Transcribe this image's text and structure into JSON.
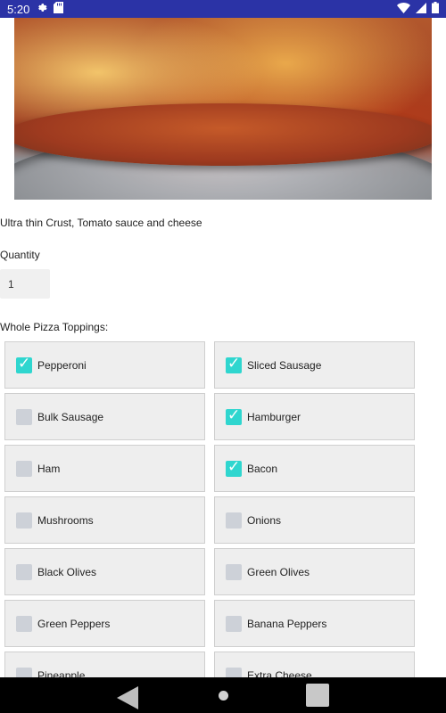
{
  "status_bar": {
    "time": "5:20",
    "left_icons": [
      "gear-icon",
      "sd-card-icon"
    ],
    "right_icons": [
      "wifi-icon",
      "cellular-icon",
      "battery-icon"
    ]
  },
  "product": {
    "description": "Ultra thin Crust, Tomato sauce and cheese"
  },
  "quantity": {
    "label": "Quantity",
    "value": "1"
  },
  "toppings": {
    "label": "Whole Pizza Toppings:",
    "items": [
      {
        "label": "Pepperoni",
        "checked": true
      },
      {
        "label": "Sliced Sausage",
        "checked": true
      },
      {
        "label": "Bulk Sausage",
        "checked": false
      },
      {
        "label": "Hamburger",
        "checked": true
      },
      {
        "label": "Ham",
        "checked": false
      },
      {
        "label": "Bacon",
        "checked": true
      },
      {
        "label": "Mushrooms",
        "checked": false
      },
      {
        "label": "Onions",
        "checked": false
      },
      {
        "label": "Black Olives",
        "checked": false
      },
      {
        "label": "Green Olives",
        "checked": false
      },
      {
        "label": "Green Peppers",
        "checked": false
      },
      {
        "label": "Banana Peppers",
        "checked": false
      },
      {
        "label": "Pineapple",
        "checked": false
      },
      {
        "label": "Extra Cheese",
        "checked": false
      }
    ]
  },
  "nav_bar": {
    "icons": [
      "back-icon",
      "home-icon",
      "recents-icon"
    ]
  },
  "colors": {
    "status_bar": "#2b33a6",
    "checkbox_checked": "#2fd6cf",
    "checkbox_unchecked": "#cdd1d8",
    "topping_cell": "#eeeeee"
  }
}
